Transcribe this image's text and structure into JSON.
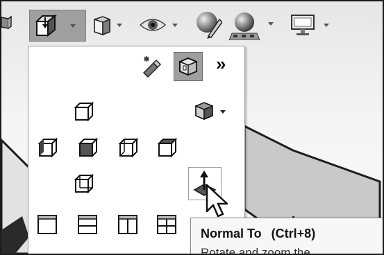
{
  "toolbar": {
    "items": [
      {
        "icon": "view-orientation-icon",
        "has_dropdown": true,
        "active": true
      },
      {
        "icon": "display-style-icon",
        "has_dropdown": true
      },
      {
        "icon": "hide-show-items-icon",
        "has_dropdown": true
      },
      {
        "icon": "edit-appearance-icon",
        "has_dropdown": false
      },
      {
        "icon": "apply-scene-icon",
        "has_dropdown": true
      },
      {
        "icon": "view-settings-icon",
        "has_dropdown": true
      }
    ]
  },
  "flyout": {
    "top_row": {
      "icons": [
        "view-selector-flashlight-icon",
        "view-cube-selector-icon"
      ],
      "expand_label": "»"
    },
    "standard_views": [
      {
        "name": "front-view-icon"
      },
      {
        "name": "isometric-view-icon"
      },
      {
        "name": "left-view-icon"
      },
      {
        "name": "top-view-icon"
      },
      {
        "name": "right-view-icon"
      },
      {
        "name": "bottom-view-icon"
      },
      {
        "name": "back-view-icon"
      },
      {
        "name": "normal-to-icon"
      }
    ],
    "viewport_layouts": [
      "single-view-icon",
      "two-view-horizontal-icon",
      "two-view-vertical-icon",
      "four-view-icon"
    ]
  },
  "tooltip": {
    "title": "Normal To",
    "shortcut": "(Ctrl+8)",
    "description": "Rotate and zoom the"
  },
  "colors": {
    "active_button": "#9f9f9f",
    "panel_border": "#9a9a9a",
    "tooltip_bg": "#f7f7f7"
  }
}
